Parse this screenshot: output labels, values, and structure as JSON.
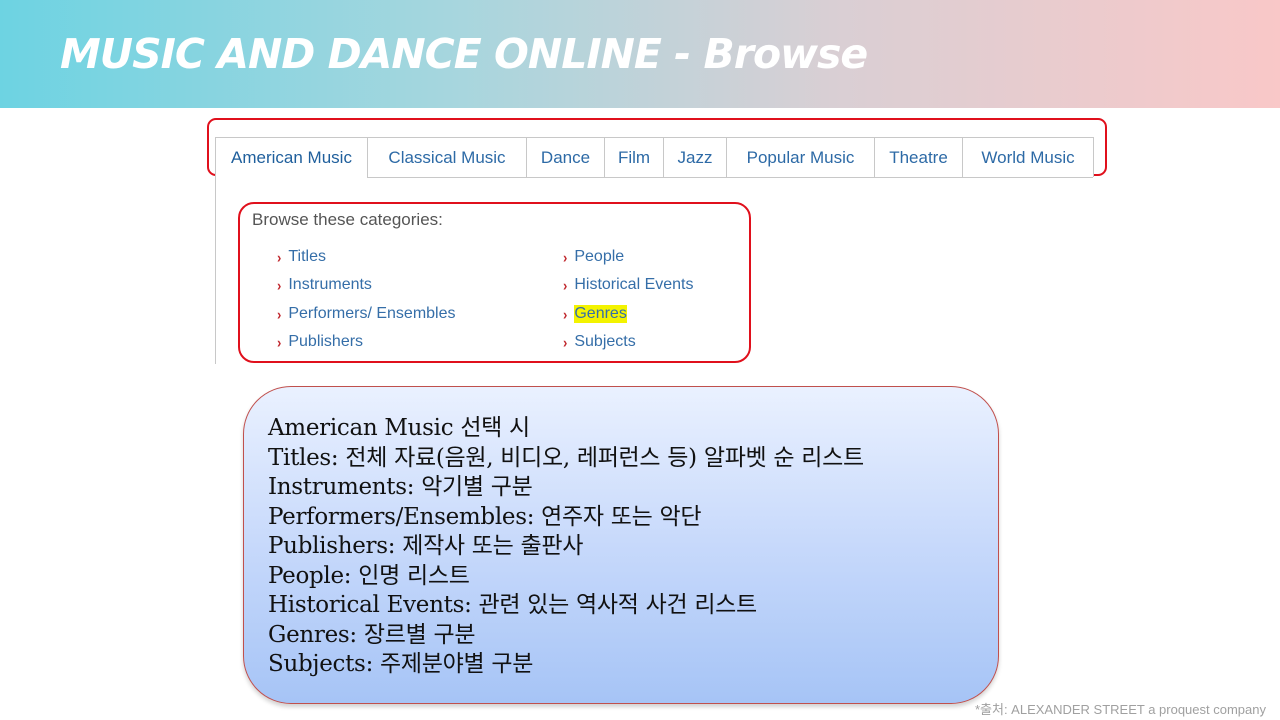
{
  "header": {
    "title": "MUSIC AND DANCE ONLINE - Browse"
  },
  "tabs": [
    "American Music",
    "Classical Music",
    "Dance",
    "Film",
    "Jazz",
    "Popular Music",
    "Theatre",
    "World Music"
  ],
  "browse": {
    "heading": "Browse these categories:",
    "chevron": "›",
    "left": [
      "Titles",
      "Instruments",
      "Performers/ Ensembles",
      "Publishers"
    ],
    "right": [
      "People",
      "Historical Events",
      "Genres",
      "Subjects"
    ],
    "highlighted": "Genres"
  },
  "note": {
    "lines": [
      "American Music 선택 시",
      "Titles: 전체 자료(음원, 비디오, 레퍼런스 등) 알파벳 순 리스트",
      "Instruments: 악기별 구분",
      "Performers/Ensembles: 연주자 또는 악단",
      "Publishers: 제작사 또는 출판사",
      "People: 인명 리스트",
      "Historical Events: 관련 있는 역사적 사건 리스트",
      "Genres: 장르별 구분",
      "Subjects: 주제분야별 구분"
    ]
  },
  "footer": {
    "source": "*출처: ALEXANDER STREET a proquest company"
  },
  "colors": {
    "accent_red": "#e0101c",
    "link_blue": "#356ea8",
    "highlight": "#f3f300"
  }
}
